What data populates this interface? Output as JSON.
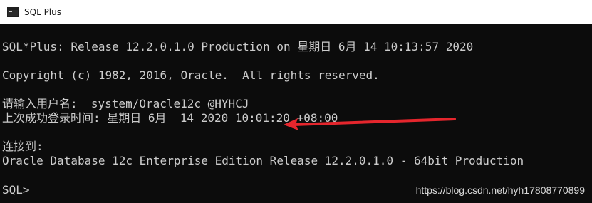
{
  "window": {
    "title": "SQL Plus",
    "icon": "console-window-icon"
  },
  "console": {
    "lines": [
      "SQL*Plus: Release 12.2.0.1.0 Production on 星期日 6月 14 10:13:57 2020",
      "Copyright (c) 1982, 2016, Oracle.  All rights reserved.",
      "请输入用户名:  system/Oracle12c @HYHCJ",
      "上次成功登录时间: 星期日 6月  14 2020 10:01:20 +08:00",
      "连接到:",
      "Oracle Database 12c Enterprise Edition Release 12.2.0.1.0 - 64bit Production",
      "SQL>"
    ]
  },
  "annotation": {
    "arrow_color": "#e5262d",
    "arrow_icon": "red-arrow-annotation"
  },
  "watermark": "https://blog.csdn.net/hyh17808770899"
}
